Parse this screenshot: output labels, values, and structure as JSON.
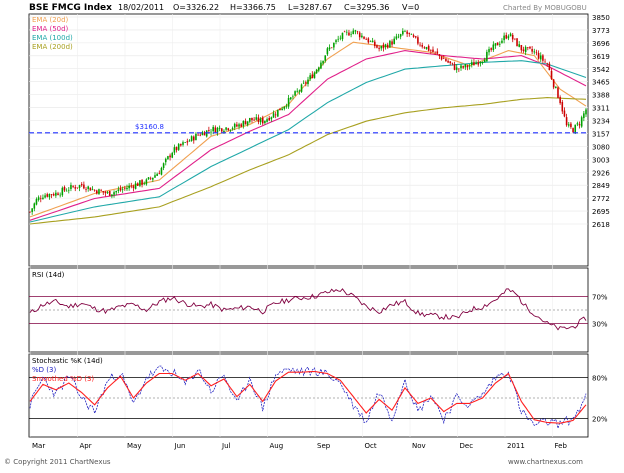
{
  "header": {
    "index_name": "BSE FMCG Index",
    "date": "18/02/2011",
    "open": "O=3326.22",
    "high": "H=3366.75",
    "low": "L=3287.67",
    "close": "C=3295.36",
    "volume": "V=0",
    "credit": "Charted By MOBUGOBU"
  },
  "footer": {
    "copyright": "© Copyright 2011 ChartNexus",
    "website": "www.chartnexus.com"
  },
  "colors": {
    "up": "#00a000",
    "down": "#cc0000",
    "ema20": "#f0a050",
    "ema50": "#e0208a",
    "ema100": "#20a8a8",
    "ema200": "#a8a020",
    "support": "#2030ff",
    "rsi": "#800040",
    "k": "#2020c0",
    "d": "#ff2020"
  },
  "chart_data": [
    {
      "type": "candlestick",
      "title": "BSE FMCG Index",
      "x_labels": [
        "Mar",
        "Apr",
        "May",
        "Jun",
        "Jul",
        "Aug",
        "Sep",
        "Oct",
        "Nov",
        "Dec",
        "2011",
        "Feb"
      ],
      "y_ticks": [
        "3850",
        "3773",
        "3696",
        "3619",
        "3542",
        "3465",
        "3388",
        "3311",
        "3234",
        "3157",
        "3080",
        "3003",
        "2926",
        "2849",
        "2772",
        "2695",
        "2618"
      ],
      "ylim": [
        2618,
        3850
      ],
      "legend": [
        {
          "name": "EMA (20d)",
          "color": "#f0a050"
        },
        {
          "name": "EMA (50d)",
          "color": "#e0208a"
        },
        {
          "name": "EMA (100d)",
          "color": "#20a8a8"
        },
        {
          "name": "EMA (200d)",
          "color": "#a8a020"
        }
      ],
      "support_label": "$3160.8",
      "support_value": 3160.8,
      "close_path": [
        [
          0,
          2690
        ],
        [
          3,
          2760
        ],
        [
          6,
          2790
        ],
        [
          12,
          2800
        ],
        [
          18,
          2830
        ],
        [
          24,
          2850
        ],
        [
          30,
          2820
        ],
        [
          36,
          2800
        ],
        [
          42,
          2820
        ],
        [
          48,
          2850
        ],
        [
          54,
          2870
        ],
        [
          60,
          2930
        ],
        [
          66,
          3050
        ],
        [
          72,
          3100
        ],
        [
          78,
          3150
        ],
        [
          84,
          3180
        ],
        [
          90,
          3190
        ],
        [
          96,
          3200
        ],
        [
          102,
          3240
        ],
        [
          108,
          3230
        ],
        [
          114,
          3280
        ],
        [
          120,
          3350
        ],
        [
          126,
          3430
        ],
        [
          132,
          3520
        ],
        [
          138,
          3650
        ],
        [
          144,
          3730
        ],
        [
          150,
          3770
        ],
        [
          156,
          3720
        ],
        [
          162,
          3660
        ],
        [
          168,
          3700
        ],
        [
          174,
          3760
        ],
        [
          180,
          3700
        ],
        [
          186,
          3650
        ],
        [
          192,
          3600
        ],
        [
          198,
          3540
        ],
        [
          204,
          3560
        ],
        [
          210,
          3600
        ],
        [
          216,
          3680
        ],
        [
          222,
          3750
        ],
        [
          228,
          3660
        ],
        [
          234,
          3640
        ],
        [
          240,
          3570
        ],
        [
          243,
          3450
        ],
        [
          246,
          3350
        ],
        [
          249,
          3200
        ],
        [
          252,
          3180
        ],
        [
          255,
          3220
        ],
        [
          258,
          3300
        ]
      ],
      "ema_series": [
        {
          "name": "EMA (20d)",
          "values": [
            [
              0,
              2660
            ],
            [
              30,
              2800
            ],
            [
              60,
              2880
            ],
            [
              84,
              3140
            ],
            [
              102,
              3210
            ],
            [
              120,
              3330
            ],
            [
              138,
              3600
            ],
            [
              150,
              3700
            ],
            [
              168,
              3670
            ],
            [
              186,
              3640
            ],
            [
              204,
              3560
            ],
            [
              222,
              3650
            ],
            [
              234,
              3620
            ],
            [
              246,
              3420
            ],
            [
              258,
              3320
            ]
          ]
        },
        {
          "name": "EMA (50d)",
          "values": [
            [
              0,
              2640
            ],
            [
              30,
              2770
            ],
            [
              60,
              2830
            ],
            [
              84,
              3060
            ],
            [
              102,
              3170
            ],
            [
              120,
              3270
            ],
            [
              138,
              3480
            ],
            [
              156,
              3600
            ],
            [
              174,
              3650
            ],
            [
              192,
              3620
            ],
            [
              210,
              3600
            ],
            [
              228,
              3620
            ],
            [
              240,
              3560
            ],
            [
              258,
              3440
            ]
          ]
        },
        {
          "name": "EMA (100d)",
          "values": [
            [
              0,
              2630
            ],
            [
              30,
              2720
            ],
            [
              60,
              2780
            ],
            [
              84,
              2960
            ],
            [
              102,
              3070
            ],
            [
              120,
              3180
            ],
            [
              138,
              3340
            ],
            [
              156,
              3460
            ],
            [
              174,
              3540
            ],
            [
              192,
              3560
            ],
            [
              210,
              3580
            ],
            [
              228,
              3590
            ],
            [
              240,
              3570
            ],
            [
              258,
              3490
            ]
          ]
        },
        {
          "name": "EMA (200d)",
          "values": [
            [
              0,
              2618
            ],
            [
              30,
              2660
            ],
            [
              60,
              2720
            ],
            [
              84,
              2840
            ],
            [
              102,
              2940
            ],
            [
              120,
              3030
            ],
            [
              138,
              3150
            ],
            [
              156,
              3230
            ],
            [
              174,
              3280
            ],
            [
              192,
              3310
            ],
            [
              210,
              3330
            ],
            [
              228,
              3360
            ],
            [
              240,
              3370
            ],
            [
              258,
              3360
            ]
          ]
        }
      ]
    },
    {
      "type": "line",
      "title": "RSI (14d)",
      "y_ticks": [
        "70%",
        "30%"
      ],
      "ylim": [
        0,
        100
      ],
      "levels": [
        70,
        50,
        30
      ],
      "values": [
        [
          0,
          45
        ],
        [
          6,
          58
        ],
        [
          12,
          62
        ],
        [
          18,
          55
        ],
        [
          24,
          60
        ],
        [
          30,
          52
        ],
        [
          36,
          48
        ],
        [
          42,
          55
        ],
        [
          48,
          58
        ],
        [
          54,
          50
        ],
        [
          60,
          62
        ],
        [
          66,
          68
        ],
        [
          72,
          60
        ],
        [
          78,
          55
        ],
        [
          84,
          58
        ],
        [
          90,
          50
        ],
        [
          96,
          52
        ],
        [
          102,
          55
        ],
        [
          108,
          48
        ],
        [
          114,
          60
        ],
        [
          120,
          65
        ],
        [
          126,
          68
        ],
        [
          132,
          70
        ],
        [
          138,
          76
        ],
        [
          144,
          80
        ],
        [
          150,
          70
        ],
        [
          156,
          55
        ],
        [
          162,
          48
        ],
        [
          168,
          58
        ],
        [
          174,
          62
        ],
        [
          180,
          45
        ],
        [
          186,
          42
        ],
        [
          192,
          40
        ],
        [
          198,
          38
        ],
        [
          204,
          50
        ],
        [
          210,
          55
        ],
        [
          216,
          65
        ],
        [
          222,
          80
        ],
        [
          226,
          72
        ],
        [
          230,
          55
        ],
        [
          234,
          45
        ],
        [
          240,
          30
        ],
        [
          246,
          22
        ],
        [
          252,
          25
        ],
        [
          258,
          38
        ]
      ]
    },
    {
      "type": "line",
      "title": "Stochastic %K (14d)",
      "legend": [
        {
          "name": "%D (3)",
          "color": "#2020c0"
        },
        {
          "name": "Smoothed %D (3)",
          "color": "#ff2020"
        }
      ],
      "y_ticks": [
        "80%",
        "20%"
      ],
      "ylim": [
        0,
        100
      ],
      "levels": [
        80,
        50,
        20
      ],
      "series": [
        {
          "name": "%D (3)",
          "values": [
            [
              0,
              40
            ],
            [
              6,
              80
            ],
            [
              12,
              55
            ],
            [
              18,
              82
            ],
            [
              24,
              50
            ],
            [
              30,
              30
            ],
            [
              36,
              75
            ],
            [
              42,
              88
            ],
            [
              48,
              40
            ],
            [
              54,
              80
            ],
            [
              60,
              92
            ],
            [
              66,
              88
            ],
            [
              72,
              70
            ],
            [
              78,
              92
            ],
            [
              84,
              60
            ],
            [
              90,
              85
            ],
            [
              96,
              40
            ],
            [
              102,
              80
            ],
            [
              108,
              35
            ],
            [
              114,
              85
            ],
            [
              120,
              92
            ],
            [
              126,
              88
            ],
            [
              132,
              90
            ],
            [
              138,
              85
            ],
            [
              144,
              72
            ],
            [
              150,
              40
            ],
            [
              156,
              15
            ],
            [
              162,
              60
            ],
            [
              168,
              20
            ],
            [
              174,
              80
            ],
            [
              180,
              30
            ],
            [
              186,
              55
            ],
            [
              192,
              20
            ],
            [
              198,
              50
            ],
            [
              204,
              40
            ],
            [
              210,
              55
            ],
            [
              216,
              80
            ],
            [
              222,
              90
            ],
            [
              228,
              30
            ],
            [
              234,
              10
            ],
            [
              240,
              15
            ],
            [
              246,
              12
            ],
            [
              252,
              20
            ],
            [
              258,
              50
            ]
          ]
        },
        {
          "name": "Smoothed %D (3)",
          "values": [
            [
              0,
              45
            ],
            [
              6,
              70
            ],
            [
              12,
              62
            ],
            [
              18,
              72
            ],
            [
              24,
              58
            ],
            [
              30,
              40
            ],
            [
              36,
              65
            ],
            [
              42,
              82
            ],
            [
              48,
              50
            ],
            [
              54,
              72
            ],
            [
              60,
              86
            ],
            [
              66,
              86
            ],
            [
              72,
              76
            ],
            [
              78,
              86
            ],
            [
              84,
              68
            ],
            [
              90,
              78
            ],
            [
              96,
              52
            ],
            [
              102,
              70
            ],
            [
              108,
              45
            ],
            [
              114,
              75
            ],
            [
              120,
              88
            ],
            [
              126,
              88
            ],
            [
              132,
              89
            ],
            [
              138,
              86
            ],
            [
              144,
              76
            ],
            [
              150,
              52
            ],
            [
              156,
              28
            ],
            [
              162,
              48
            ],
            [
              168,
              32
            ],
            [
              174,
              65
            ],
            [
              180,
              42
            ],
            [
              186,
              50
            ],
            [
              192,
              30
            ],
            [
              198,
              42
            ],
            [
              204,
              42
            ],
            [
              210,
              50
            ],
            [
              216,
              72
            ],
            [
              222,
              86
            ],
            [
              228,
              45
            ],
            [
              234,
              18
            ],
            [
              240,
              14
            ],
            [
              246,
              13
            ],
            [
              252,
              17
            ],
            [
              258,
              40
            ]
          ]
        }
      ]
    }
  ]
}
